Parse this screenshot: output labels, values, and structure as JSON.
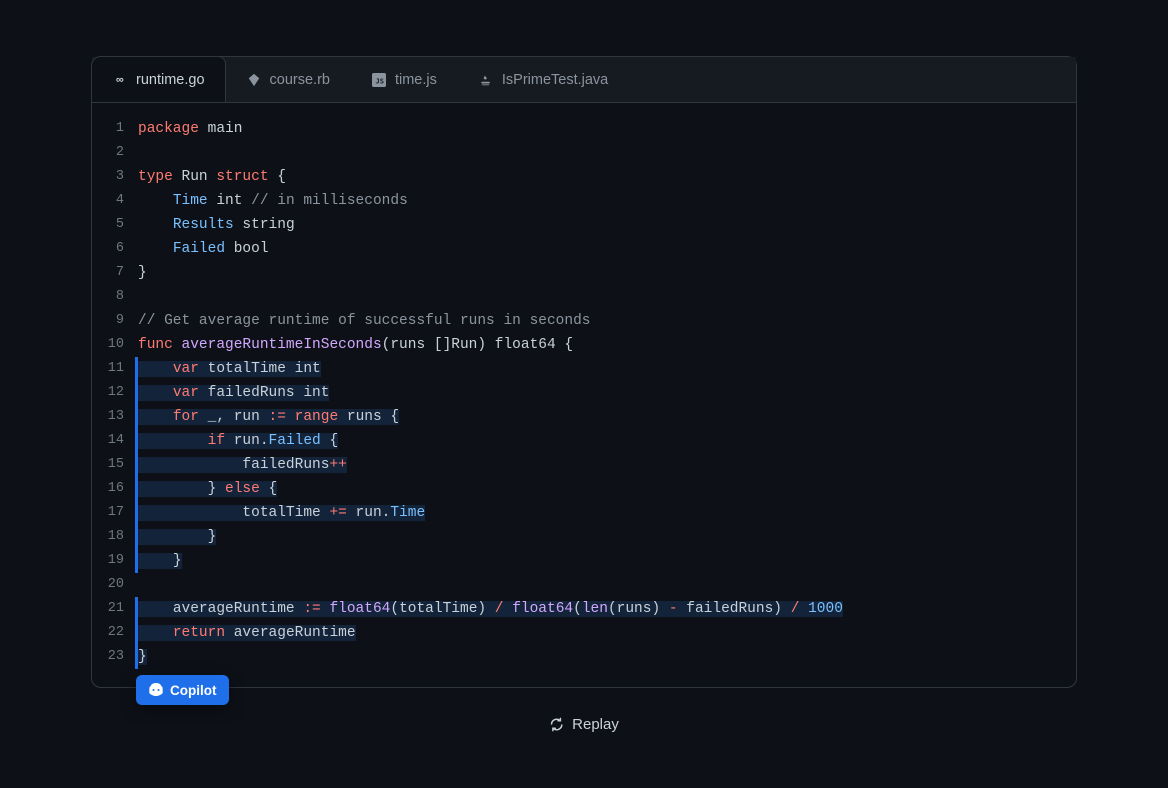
{
  "tabs": [
    {
      "label": "runtime.go",
      "iconName": "go-icon",
      "active": true
    },
    {
      "label": "course.rb",
      "iconName": "ruby-icon",
      "active": false
    },
    {
      "label": "time.js",
      "iconName": "js-icon",
      "active": false
    },
    {
      "label": "IsPrimeTest.java",
      "iconName": "java-icon",
      "active": false
    }
  ],
  "code": {
    "lines": [
      {
        "n": 1,
        "hl": false,
        "segs": [
          [
            "kw",
            "package"
          ],
          [
            "main",
            " main"
          ]
        ]
      },
      {
        "n": 2,
        "hl": false,
        "segs": [
          [
            "",
            ""
          ]
        ]
      },
      {
        "n": 3,
        "hl": false,
        "segs": [
          [
            "kw",
            "type"
          ],
          [
            "id",
            " Run "
          ],
          [
            "kw",
            "struct"
          ],
          [
            "pn",
            " {"
          ]
        ]
      },
      {
        "n": 4,
        "hl": false,
        "segs": [
          [
            "",
            "    "
          ],
          [
            "field",
            "Time"
          ],
          [
            "id",
            " int "
          ],
          [
            "cm",
            "// in milliseconds"
          ]
        ]
      },
      {
        "n": 5,
        "hl": false,
        "segs": [
          [
            "",
            "    "
          ],
          [
            "field",
            "Results"
          ],
          [
            "id",
            " string"
          ]
        ]
      },
      {
        "n": 6,
        "hl": false,
        "segs": [
          [
            "",
            "    "
          ],
          [
            "field",
            "Failed"
          ],
          [
            "id",
            " bool"
          ]
        ]
      },
      {
        "n": 7,
        "hl": false,
        "segs": [
          [
            "pn",
            "}"
          ]
        ]
      },
      {
        "n": 8,
        "hl": false,
        "segs": [
          [
            "",
            ""
          ]
        ]
      },
      {
        "n": 9,
        "hl": false,
        "segs": [
          [
            "cm",
            "// Get average runtime of successful runs in seconds"
          ]
        ]
      },
      {
        "n": 10,
        "hl": false,
        "segs": [
          [
            "kw",
            "func"
          ],
          [
            "fn",
            " averageRuntimeInSeconds"
          ],
          [
            "pn",
            "(runs []Run)"
          ],
          [
            "id",
            " float64 "
          ],
          [
            "pn",
            "{"
          ]
        ]
      },
      {
        "n": 11,
        "hl": true,
        "hlspan": [
          [
            "",
            "    "
          ],
          [
            "kw",
            "var"
          ],
          [
            "id",
            " totalTime int"
          ]
        ]
      },
      {
        "n": 12,
        "hl": true,
        "hlspan": [
          [
            "",
            "    "
          ],
          [
            "kw",
            "var"
          ],
          [
            "id",
            " failedRuns int"
          ]
        ]
      },
      {
        "n": 13,
        "hl": true,
        "hlspan": [
          [
            "",
            "    "
          ],
          [
            "kw",
            "for"
          ],
          [
            "id",
            " _"
          ],
          [
            "pn",
            ","
          ],
          [
            "id",
            " run "
          ],
          [
            "op",
            ":= "
          ],
          [
            "kw",
            "range"
          ],
          [
            "id",
            " runs "
          ],
          [
            "pn",
            "{"
          ]
        ]
      },
      {
        "n": 14,
        "hl": true,
        "hlspan": [
          [
            "",
            "        "
          ],
          [
            "kw",
            "if"
          ],
          [
            "id",
            " run"
          ],
          [
            "pn",
            "."
          ],
          [
            "field",
            "Failed"
          ],
          [
            "pn",
            " {"
          ]
        ]
      },
      {
        "n": 15,
        "hl": true,
        "hlspan": [
          [
            "",
            "            "
          ],
          [
            "id",
            "failedRuns"
          ],
          [
            "op",
            "++"
          ]
        ]
      },
      {
        "n": 16,
        "hl": true,
        "hlspan": [
          [
            "",
            "        "
          ],
          [
            "pn",
            "} "
          ],
          [
            "kw",
            "else"
          ],
          [
            "pn",
            " {"
          ]
        ]
      },
      {
        "n": 17,
        "hl": true,
        "hlspan": [
          [
            "",
            "            "
          ],
          [
            "id",
            "totalTime "
          ],
          [
            "op",
            "+="
          ],
          [
            "id",
            " run"
          ],
          [
            "pn",
            "."
          ],
          [
            "field",
            "Time"
          ]
        ]
      },
      {
        "n": 18,
        "hl": true,
        "hlspan": [
          [
            "",
            "        "
          ],
          [
            "pn",
            "}"
          ]
        ]
      },
      {
        "n": 19,
        "hl": true,
        "hlspan": [
          [
            "",
            "    "
          ],
          [
            "pn",
            "}"
          ]
        ]
      },
      {
        "n": 20,
        "hl": true,
        "hlspan": [
          [
            "",
            ""
          ]
        ]
      },
      {
        "n": 21,
        "hl": true,
        "hlspan": [
          [
            "",
            "    "
          ],
          [
            "id",
            "averageRuntime "
          ],
          [
            "op",
            ":= "
          ],
          [
            "fn",
            "float64"
          ],
          [
            "pn",
            "(totalTime) "
          ],
          [
            "op",
            "/"
          ],
          [
            "fn",
            " float64"
          ],
          [
            "pn",
            "("
          ],
          [
            "fn",
            "len"
          ],
          [
            "pn",
            "(runs) "
          ],
          [
            "op",
            "-"
          ],
          [
            "id",
            " failedRuns"
          ],
          [
            "pn",
            ") "
          ],
          [
            "op",
            "/"
          ],
          [
            "num",
            " 1000"
          ]
        ]
      },
      {
        "n": 22,
        "hl": true,
        "hlspan": [
          [
            "",
            "    "
          ],
          [
            "kw",
            "return"
          ],
          [
            "id",
            " averageRuntime"
          ]
        ]
      },
      {
        "n": 23,
        "hl": true,
        "hlspan": [
          [
            "pn",
            "}"
          ]
        ]
      }
    ]
  },
  "copilot": {
    "label": "Copilot"
  },
  "replay": {
    "label": "Replay"
  }
}
